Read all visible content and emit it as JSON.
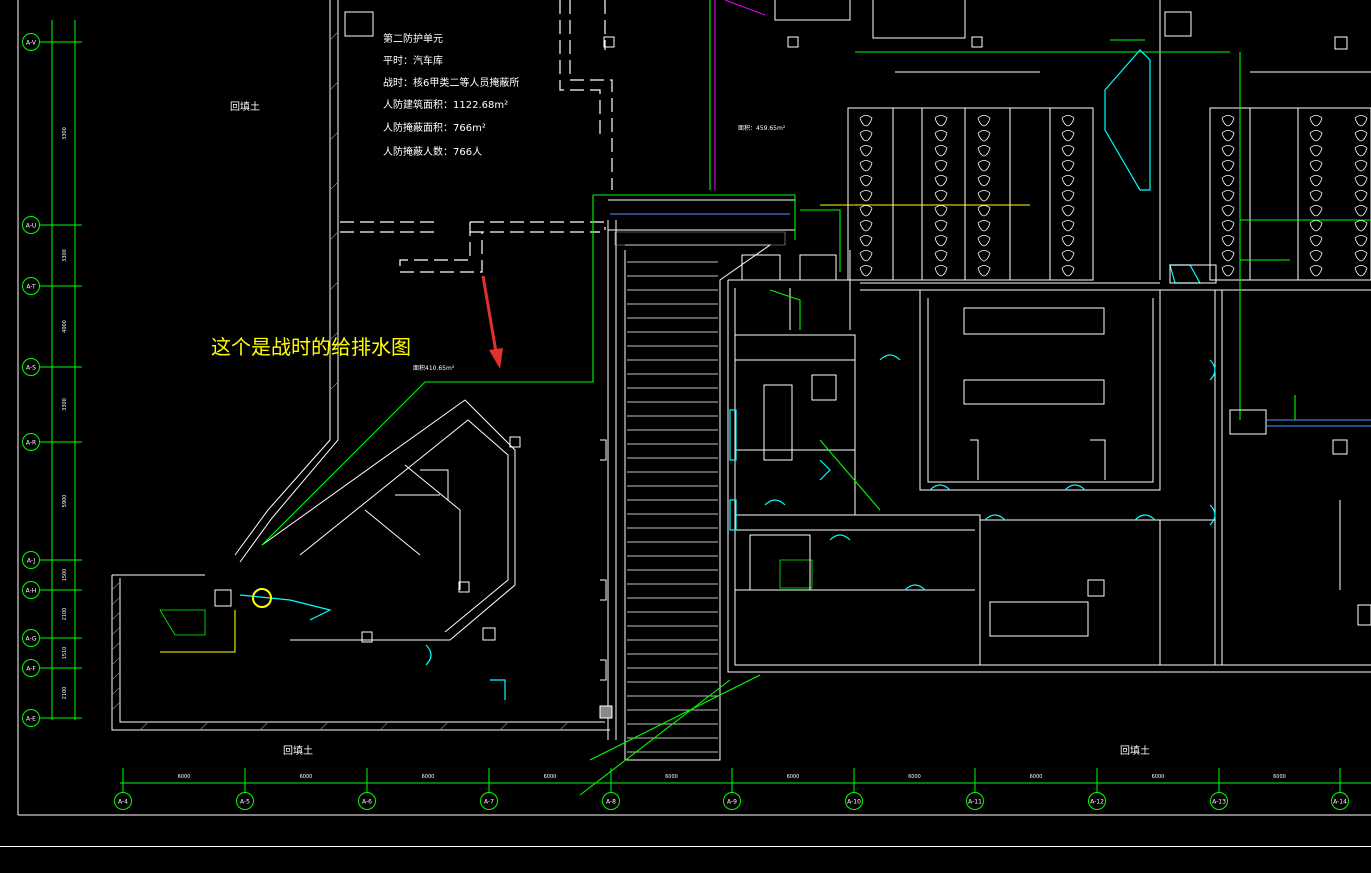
{
  "colors": {
    "background": "#000000",
    "wall": "#ffffff",
    "pipe_green": "#00ff00",
    "accent_cyan": "#00ffff",
    "text_yellow": "#ffff00",
    "arrow_red": "#e03030",
    "magenta": "#ff00ff"
  },
  "annotation": {
    "text": "这个是战时的给排水图",
    "arrow": "red-arrow"
  },
  "info_block": {
    "lines": [
      "第二防护单元",
      "平时：汽车库",
      "战时：核6甲类二等人员掩蔽所",
      "人防建筑面积：1122.68m²",
      "人防掩蔽面积：766m²",
      "人防掩蔽人数：766人"
    ]
  },
  "labels": {
    "backfill_top": "回填土",
    "backfill_bottom_left": "回填土",
    "backfill_bottom_right": "回填土",
    "area_text": "面积：459.65m²",
    "area_label2": "面积410.65m²"
  },
  "left_axis": {
    "bubbles": [
      "A-V",
      "A-U",
      "A-T",
      "A-S",
      "A-R",
      "A-J",
      "A-H",
      "A-G",
      "A-F",
      "A-E"
    ],
    "dims": [
      "3300",
      "3300",
      "4000",
      "3300",
      "5900",
      "1500",
      "2100",
      "1510",
      "2100"
    ]
  },
  "bottom_axis": {
    "bubbles": [
      "A-4",
      "A-5",
      "A-6",
      "A-7",
      "A-8",
      "A-9",
      "A-10",
      "A-11",
      "A-12",
      "A-13",
      "A-14"
    ],
    "dims": [
      "6000",
      "6000",
      "6000",
      "6000",
      "6000",
      "6000",
      "6000",
      "6000",
      "6000",
      "6000"
    ]
  }
}
